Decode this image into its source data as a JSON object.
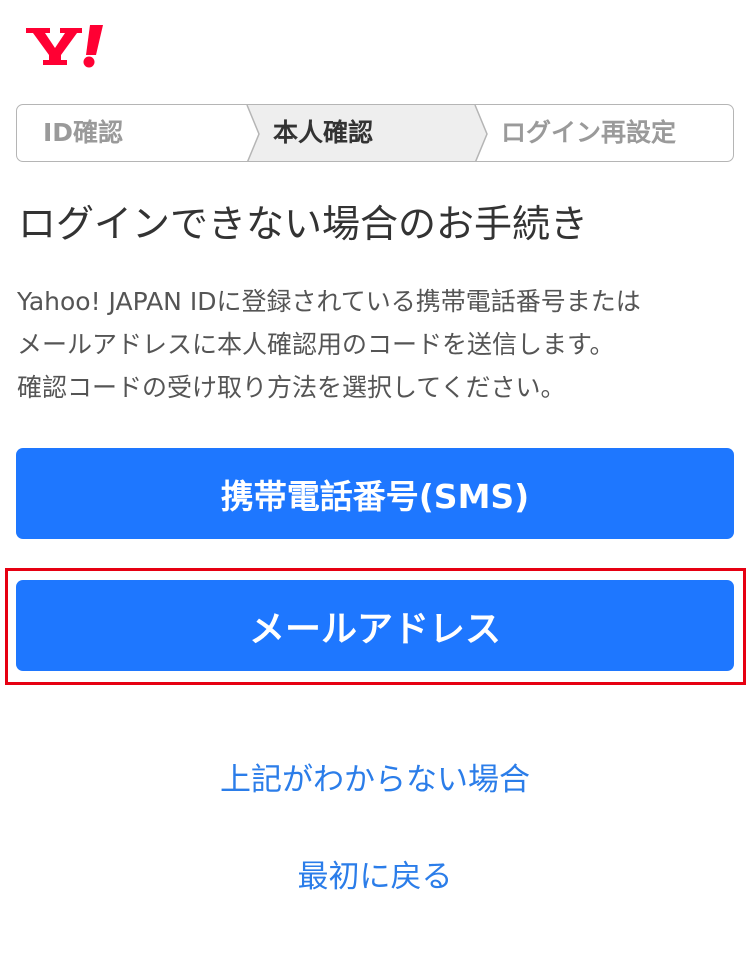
{
  "brand": {
    "logo_text": "Y!",
    "logo_color": "#ff0033"
  },
  "steps": [
    {
      "label": "ID確認",
      "state": "done"
    },
    {
      "label": "本人確認",
      "state": "current"
    },
    {
      "label": "ログイン再設定",
      "state": "upcoming"
    }
  ],
  "page": {
    "title": "ログインできない場合のお手続き",
    "description_lines": [
      "Yahoo! JAPAN IDに登録されている携帯電話番号または",
      "メールアドレスに本人確認用のコードを送信します。",
      "確認コードの受け取り方法を選択してください。"
    ]
  },
  "buttons": {
    "sms_label": "携帯電話番号(SMS)",
    "email_label": "メールアドレス"
  },
  "links": {
    "unknown_label": "上記がわからない場合",
    "back_label": "最初に戻る"
  },
  "colors": {
    "primary_button": "#1e77ff",
    "link": "#2b7de9",
    "highlight_border": "#e60012",
    "current_step_bg": "#eeeeee"
  }
}
